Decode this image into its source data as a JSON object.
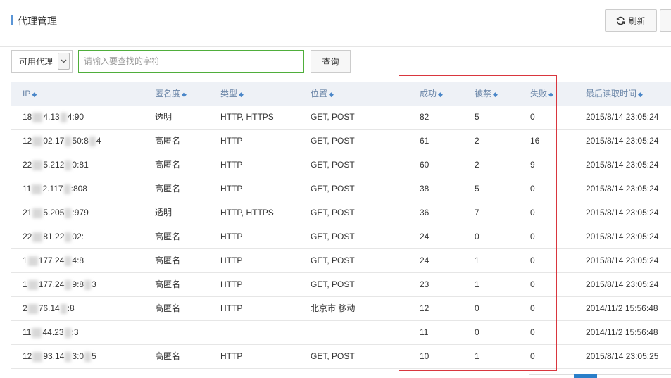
{
  "header": {
    "title": "代理管理",
    "refresh_label": "刷新",
    "refresh_icon": "refresh-icon"
  },
  "filter": {
    "select_value": "可用代理",
    "search_placeholder": "请输入要查找的字符",
    "query_label": "查询"
  },
  "table": {
    "columns": [
      "IP",
      "匿名度",
      "类型",
      "位置",
      "成功",
      "被禁",
      "失败",
      "最后读取时间"
    ],
    "sort_icon": "sort-arrows-icon",
    "rows": [
      {
        "ip_parts": [
          "18",
          "4.13",
          "4:90"
        ],
        "anonymity": "透明",
        "type": "HTTP, HTTPS",
        "location": "GET, POST",
        "success": "82",
        "banned": "5",
        "failed": "0",
        "last_read": "2015/8/14 23:05:24"
      },
      {
        "ip_parts": [
          "12",
          "02.17",
          "50:8",
          "4"
        ],
        "anonymity": "高匿名",
        "type": "HTTP",
        "location": "GET, POST",
        "success": "61",
        "banned": "2",
        "failed": "16",
        "last_read": "2015/8/14 23:05:24"
      },
      {
        "ip_parts": [
          "22",
          "5.212",
          "0:81"
        ],
        "anonymity": "高匿名",
        "type": "HTTP",
        "location": "GET, POST",
        "success": "60",
        "banned": "2",
        "failed": "9",
        "last_read": "2015/8/14 23:05:24"
      },
      {
        "ip_parts": [
          "11",
          "2.117",
          ":808"
        ],
        "anonymity": "高匿名",
        "type": "HTTP",
        "location": "GET, POST",
        "success": "38",
        "banned": "5",
        "failed": "0",
        "last_read": "2015/8/14 23:05:24"
      },
      {
        "ip_parts": [
          "21",
          "5.205",
          ":979"
        ],
        "anonymity": "透明",
        "type": "HTTP, HTTPS",
        "location": "GET, POST",
        "success": "36",
        "banned": "7",
        "failed": "0",
        "last_read": "2015/8/14 23:05:24"
      },
      {
        "ip_parts": [
          "22",
          "81.22",
          "02:"
        ],
        "anonymity": "高匿名",
        "type": "HTTP",
        "location": "GET, POST",
        "success": "24",
        "banned": "0",
        "failed": "0",
        "last_read": "2015/8/14 23:05:24"
      },
      {
        "ip_parts": [
          "1",
          "177.24",
          "4:8"
        ],
        "anonymity": "高匿名",
        "type": "HTTP",
        "location": "GET, POST",
        "success": "24",
        "banned": "1",
        "failed": "0",
        "last_read": "2015/8/14 23:05:24"
      },
      {
        "ip_parts": [
          "1",
          "177.24",
          "9:8",
          "3"
        ],
        "anonymity": "高匿名",
        "type": "HTTP",
        "location": "GET, POST",
        "success": "23",
        "banned": "1",
        "failed": "0",
        "last_read": "2015/8/14 23:05:24"
      },
      {
        "ip_parts": [
          "2",
          "76.14",
          ":8"
        ],
        "anonymity": "高匿名",
        "type": "HTTP",
        "location": "北京市 移动",
        "success": "12",
        "banned": "0",
        "failed": "0",
        "last_read": "2014/11/2 15:56:48"
      },
      {
        "ip_parts": [
          "11",
          "44.23",
          ":3"
        ],
        "anonymity": "",
        "type": "",
        "location": "",
        "success": "11",
        "banned": "0",
        "failed": "0",
        "last_read": "2014/11/2 15:56:48"
      },
      {
        "ip_parts": [
          "12",
          "93.14",
          "3:0",
          "5"
        ],
        "anonymity": "高匿名",
        "type": "HTTP",
        "location": "GET, POST",
        "success": "10",
        "banned": "1",
        "failed": "0",
        "last_read": "2015/8/14 23:05:25"
      }
    ]
  },
  "colors": {
    "highlight": "#d9363e",
    "accent": "#4a86c8",
    "search_border": "#4fae3b"
  }
}
